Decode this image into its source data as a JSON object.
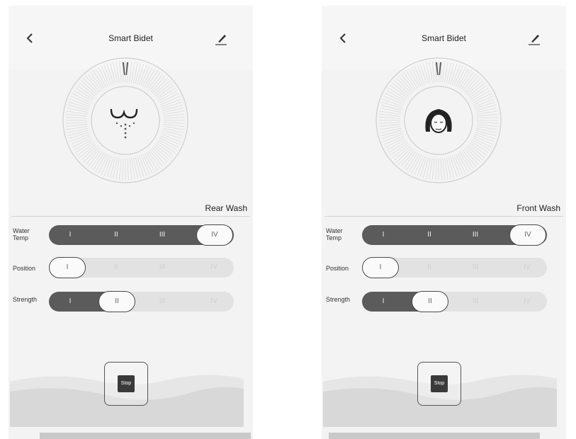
{
  "colors": {
    "accent": "#5b5b5b",
    "background": "#f3f3f3"
  },
  "left": {
    "title": "Smart Bidet",
    "mode": "Rear Wash",
    "dial_icon": "rear-wash-icon",
    "rows": [
      {
        "label": "Water Temp",
        "levels": [
          "I",
          "II",
          "III",
          "IV"
        ],
        "selected": 4
      },
      {
        "label": "Position",
        "levels": [
          "I",
          "II",
          "III",
          "IV"
        ],
        "selected": 1
      },
      {
        "label": "Strength",
        "levels": [
          "I",
          "II",
          "III",
          "IV"
        ],
        "selected": 2
      }
    ],
    "stop_label": "Stop"
  },
  "right": {
    "title": "Smart Bidet",
    "mode": "Front Wash",
    "dial_icon": "front-wash-icon",
    "rows": [
      {
        "label": "Water Temp",
        "levels": [
          "I",
          "II",
          "III",
          "IV"
        ],
        "selected": 4
      },
      {
        "label": "Position",
        "levels": [
          "I",
          "II",
          "III",
          "IV"
        ],
        "selected": 1
      },
      {
        "label": "Strength",
        "levels": [
          "I",
          "II",
          "III",
          "IV"
        ],
        "selected": 2
      }
    ],
    "stop_label": "Stop"
  }
}
